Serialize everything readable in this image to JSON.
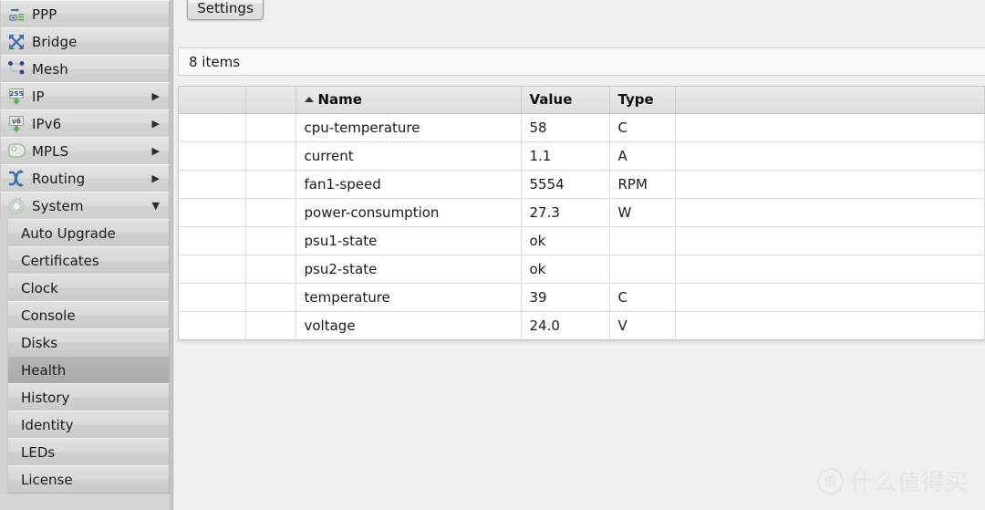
{
  "sidebar": {
    "main_items": [
      {
        "label": "PPP",
        "icon": "ppp-icon",
        "arrow": ""
      },
      {
        "label": "Bridge",
        "icon": "bridge-icon",
        "arrow": ""
      },
      {
        "label": "Mesh",
        "icon": "mesh-icon",
        "arrow": ""
      },
      {
        "label": "IP",
        "icon": "ip-icon",
        "arrow": "▶"
      },
      {
        "label": "IPv6",
        "icon": "ipv6-icon",
        "arrow": "▶"
      },
      {
        "label": "MPLS",
        "icon": "mpls-icon",
        "arrow": "▶"
      },
      {
        "label": "Routing",
        "icon": "routing-icon",
        "arrow": "▶"
      },
      {
        "label": "System",
        "icon": "system-icon",
        "arrow": "▼"
      }
    ],
    "sub_items": [
      {
        "label": "Auto Upgrade",
        "selected": false
      },
      {
        "label": "Certificates",
        "selected": false
      },
      {
        "label": "Clock",
        "selected": false
      },
      {
        "label": "Console",
        "selected": false
      },
      {
        "label": "Disks",
        "selected": false
      },
      {
        "label": "Health",
        "selected": true
      },
      {
        "label": "History",
        "selected": false
      },
      {
        "label": "Identity",
        "selected": false
      },
      {
        "label": "LEDs",
        "selected": false
      },
      {
        "label": "License",
        "selected": false
      }
    ]
  },
  "toolbar": {
    "settings_label": "Settings"
  },
  "status": {
    "items_count": "8 items"
  },
  "table": {
    "columns": [
      "",
      "",
      "Name",
      "Value",
      "Type",
      ""
    ],
    "sort_column": "Name",
    "sort_direction": "ascending",
    "rows": [
      {
        "name": "cpu-temperature",
        "value": "58",
        "type": "C"
      },
      {
        "name": "current",
        "value": "1.1",
        "type": "A"
      },
      {
        "name": "fan1-speed",
        "value": "5554",
        "type": "RPM"
      },
      {
        "name": "power-consumption",
        "value": "27.3",
        "type": "W"
      },
      {
        "name": "psu1-state",
        "value": "ok",
        "type": ""
      },
      {
        "name": "psu2-state",
        "value": "ok",
        "type": ""
      },
      {
        "name": "temperature",
        "value": "39",
        "type": "C"
      },
      {
        "name": "voltage",
        "value": "24.0",
        "type": "V"
      }
    ]
  },
  "watermark": {
    "mark": "值",
    "text": "什么值得买"
  },
  "colors": {
    "selected_row": "#b0b0b0",
    "panel_bg": "#efefef",
    "sidebar_bg": "#d6d6d6",
    "grid_line": "#dcdcdc",
    "icon_blue": "#3f6fa8",
    "icon_green": "#4fae3f"
  }
}
